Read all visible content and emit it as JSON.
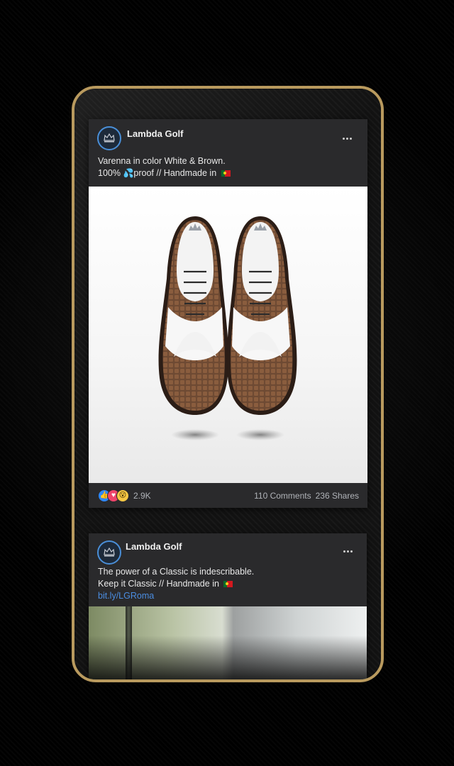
{
  "colors": {
    "frame_gold": "#b99a5e",
    "card_bg": "#2a2a2c",
    "link": "#4b8de0",
    "avatar_ring": "#4a8fd8"
  },
  "posts": [
    {
      "author": "Lambda Golf",
      "avatar_icon": "crown-logo-icon",
      "more_icon": "more-options-icon",
      "text_line1": "Varenna in color White & Brown.",
      "text_line2_prefix": "100% ",
      "text_line2_suffix": "proof // Handmade in ",
      "image": "white-brown-wingtip-golf-shoes",
      "reactions": {
        "icons": [
          "like-icon",
          "love-icon",
          "wow-icon"
        ],
        "count": "2.9K",
        "comments": "110 Comments",
        "shares": "236 Shares"
      }
    },
    {
      "author": "Lambda Golf",
      "avatar_icon": "crown-logo-icon",
      "more_icon": "more-options-icon",
      "text_line1": "The power of a Classic is indescribable.",
      "text_line2": "Keep it Classic // Handmade in ",
      "link": "bit.ly/LGRoma",
      "image": "golf-club-and-white-trousers"
    }
  ]
}
